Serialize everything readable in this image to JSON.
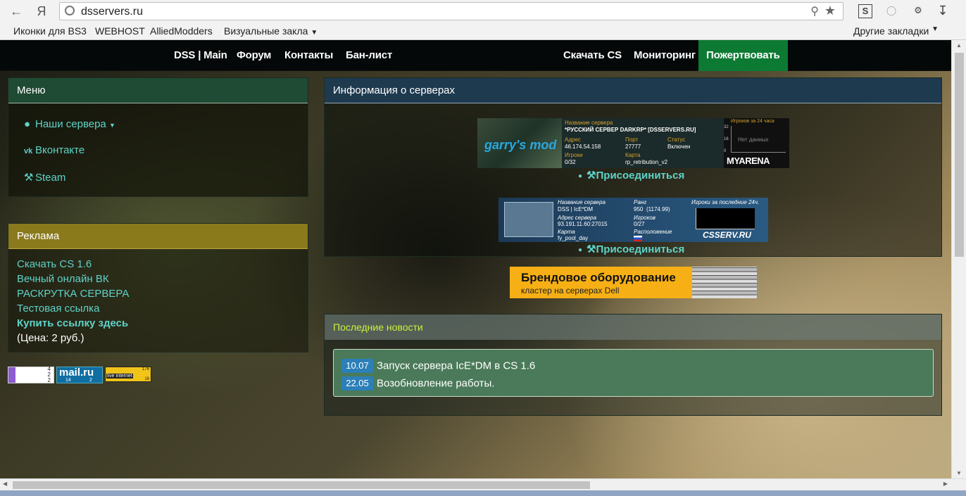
{
  "browser": {
    "url": "dsservers.ru",
    "yandex_label": "Я",
    "bookmarks": [
      "Иконки для BS3",
      "WEBHOST",
      "AlliedModders",
      "Визуальные закла"
    ],
    "other_bookmarks": "Другие закладки"
  },
  "topnav": {
    "left": [
      "DSS | Main",
      "Форум",
      "Контакты",
      "Бан-лист"
    ],
    "right": [
      "Скачать CS",
      "Мониторинг",
      "Пожертвовать"
    ]
  },
  "menu": {
    "title": "Меню",
    "items": [
      {
        "label": "Наши сервера",
        "icon": "globe-icon"
      },
      {
        "label": "Вконтакте",
        "icon": "vk-icon"
      },
      {
        "label": "Steam",
        "icon": "steam-icon"
      }
    ]
  },
  "ads": {
    "title": "Реклама",
    "links": [
      "Скачать CS 1.6",
      "Вечный онлайн ВК",
      "РАСКРУТКА СЕРВЕРА",
      "Тестовая ссылка"
    ],
    "buy": "Купить ссылку здесь",
    "price": "(Цена: 2 руб.)"
  },
  "counters": {
    "yandex": [
      "4",
      "2",
      "2"
    ],
    "mail": {
      "logo": "mail.ru",
      "a": "14",
      "b": "2"
    },
    "li": {
      "brand": "live internet",
      "v1": "176",
      "v2": "16"
    }
  },
  "servers": {
    "title": "Информация о серверах",
    "gmod": {
      "game_logo": "garry's mod",
      "lbl_name": "Название сервера",
      "name": "*РУССКИЙ СЕРВЕР DARKRP* [DSSERVERS.RU]",
      "lbl_addr": "Адрес",
      "addr": "46.174.54.158",
      "lbl_port": "Порт",
      "port": "27777",
      "lbl_status": "Статус",
      "status": "Включен",
      "lbl_players": "Игроки",
      "players": "0/32",
      "lbl_map": "Карта",
      "map": "rp_retribution_v2",
      "lbl_graph": "Игроков за 24 часа",
      "graph_ticks": [
        "32",
        "16",
        "0"
      ],
      "graph_empty": "Нет данных",
      "brand": "MYARENA"
    },
    "cs": {
      "lbl_name": "Название сервера",
      "name": "DSS | IcE*DM",
      "lbl_rank": "Ранг",
      "rank": "950",
      "rank_pts": "(1174.99)",
      "lbl_addr": "Адрес сервера",
      "addr": "93.191.11.60:27015",
      "lbl_players": "Игроков",
      "players": "0/27",
      "lbl_map": "Карта",
      "map": "fy_pool_day",
      "lbl_loc": "Расположение",
      "lbl_graph": "Игроки за последние 24ч.",
      "brand": "CSSERV.RU"
    },
    "join_label": "Присоединиться"
  },
  "promo": {
    "title": "Брендовое оборудование",
    "subtitle": "кластер на серверах Dell"
  },
  "news": {
    "title": "Последние новости",
    "items": [
      {
        "date": "10.07",
        "text": "Запуск сервера IcE*DM в CS 1.6"
      },
      {
        "date": "22.05",
        "text": "Возобновление работы."
      }
    ]
  },
  "colors": {
    "donate": "#0d7a33",
    "link": "#5fd3c8",
    "news_title": "#c9f23c"
  }
}
